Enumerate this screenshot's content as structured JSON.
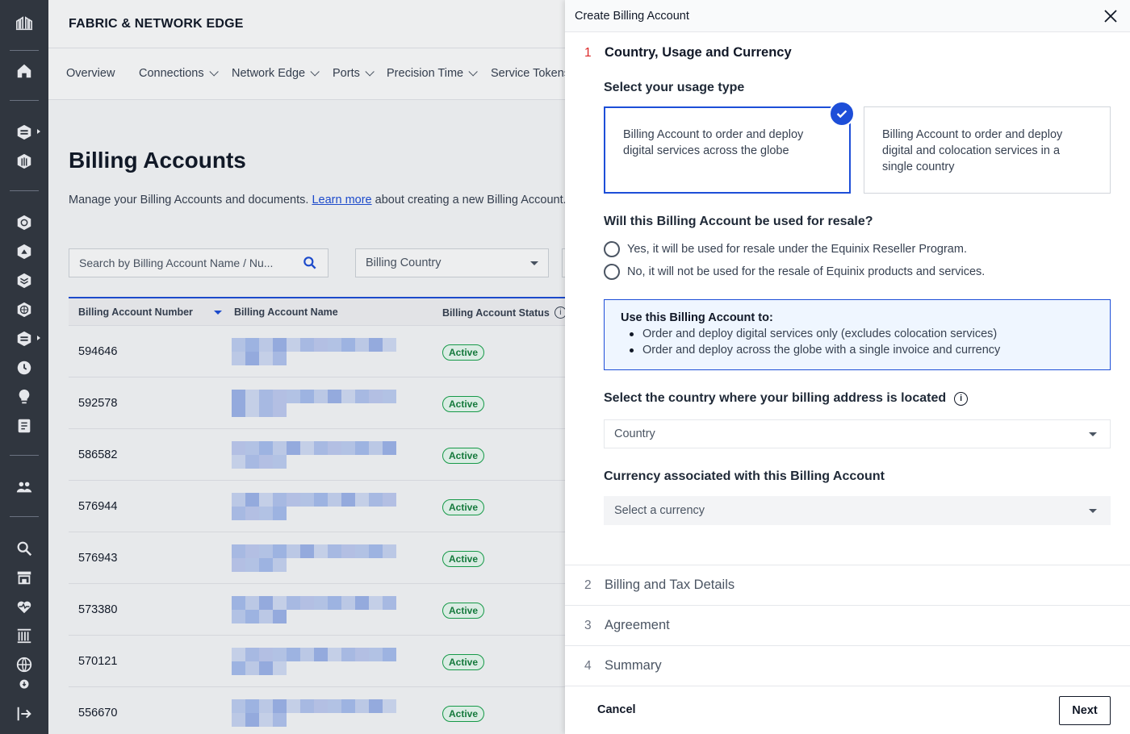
{
  "app": {
    "brand": "FABRIC & NETWORK EDGE"
  },
  "nav": {
    "items": [
      {
        "label": "Overview",
        "dropdown": false
      },
      {
        "label": "Connections",
        "dropdown": true
      },
      {
        "label": "Network Edge",
        "dropdown": true
      },
      {
        "label": "Ports",
        "dropdown": true
      },
      {
        "label": "Precision Time",
        "dropdown": true
      },
      {
        "label": "Service Tokens",
        "dropdown": false
      }
    ]
  },
  "page": {
    "title": "Billing Accounts",
    "desc_before": "Manage your Billing Accounts and documents.",
    "desc_link": "Learn more",
    "desc_after": "about creating a new Billing Account."
  },
  "filters": {
    "search_placeholder": "Search by Billing Account Name / Nu...",
    "country_label": "Billing Country"
  },
  "table": {
    "headers": {
      "number": "Billing Account Number",
      "name": "Billing Account Name",
      "status": "Billing Account Status"
    },
    "rows": [
      {
        "number": "594646",
        "status": "Active"
      },
      {
        "number": "592578",
        "status": "Active"
      },
      {
        "number": "586582",
        "status": "Active"
      },
      {
        "number": "576944",
        "status": "Active"
      },
      {
        "number": "576943",
        "status": "Active"
      },
      {
        "number": "573380",
        "status": "Active"
      },
      {
        "number": "570121",
        "status": "Active"
      },
      {
        "number": "556670",
        "status": "Active"
      }
    ]
  },
  "drawer": {
    "title": "Create Billing Account",
    "step1": {
      "num": "1",
      "label": "Country, Usage and Currency"
    },
    "usage": {
      "title": "Select your usage type",
      "option_global": "Billing Account to order and deploy digital services across the globe",
      "option_single": "Billing Account to order and deploy digital and colocation services in a single country"
    },
    "resale": {
      "title": "Will this Billing Account be used for resale?",
      "yes": "Yes, it will be used for resale under the Equinix Reseller Program.",
      "no": "No, it will not be used for the resale of Equinix products and services."
    },
    "info": {
      "title": "Use this Billing Account to:",
      "items": [
        "Order and deploy digital services only (excludes colocation services)",
        "Order and deploy across the globe with a single invoice and currency"
      ]
    },
    "country": {
      "title": "Select the country where your billing address is located",
      "placeholder": "Country"
    },
    "currency": {
      "title": "Currency associated with this Billing Account",
      "placeholder": "Select a currency"
    },
    "steps": [
      {
        "num": "2",
        "label": "Billing and Tax Details"
      },
      {
        "num": "3",
        "label": "Agreement"
      },
      {
        "num": "4",
        "label": "Summary"
      }
    ],
    "cancel_label": "Cancel",
    "next_label": "Next"
  },
  "colors": {
    "accent": "#1d4ed8",
    "rail": "#30363f",
    "active_green": "#16a34a",
    "step_active": "#dc2626"
  }
}
